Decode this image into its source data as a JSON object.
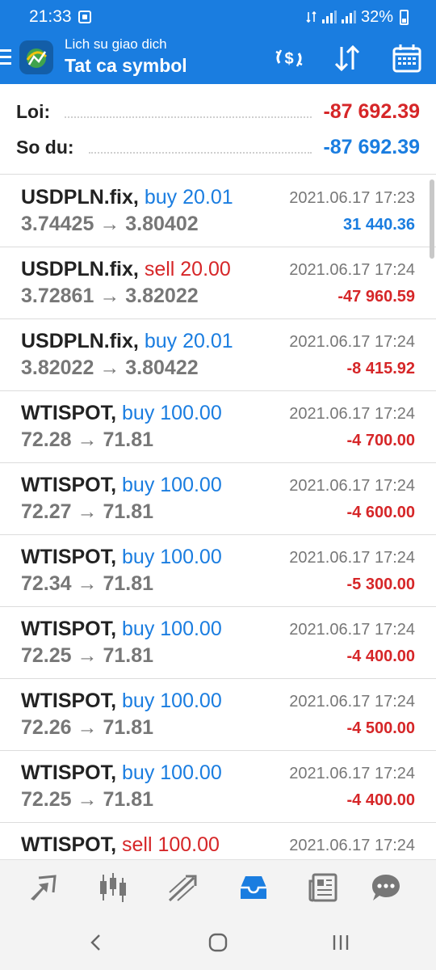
{
  "status_bar": {
    "time": "21:33",
    "battery": "32%"
  },
  "app_bar": {
    "subtitle": "Lich su giao dich",
    "title": "Tat ca symbol",
    "icons": [
      "menu-icon",
      "app-logo",
      "dollar-exchange-icon",
      "sort-arrows-icon",
      "calendar-icon"
    ]
  },
  "summary": {
    "profit_label": "Loi:",
    "profit_value": "-87 692.39",
    "balance_label": "So du:",
    "balance_value": "-87 692.39"
  },
  "deals": [
    {
      "symbol": "USDPLN.fix,",
      "side": "buy 20.01",
      "side_type": "buy",
      "prices": "3.74425 → 3.80402",
      "time": "2021.06.17 17:23",
      "profit": "31 440.36",
      "profit_sign": "positive"
    },
    {
      "symbol": "USDPLN.fix,",
      "side": "sell 20.00",
      "side_type": "sell",
      "prices": "3.72861 → 3.82022",
      "time": "2021.06.17 17:24",
      "profit": "-47 960.59",
      "profit_sign": "negative"
    },
    {
      "symbol": "USDPLN.fix,",
      "side": "buy 20.01",
      "side_type": "buy",
      "prices": "3.82022 → 3.80422",
      "time": "2021.06.17 17:24",
      "profit": "-8 415.92",
      "profit_sign": "negative"
    },
    {
      "symbol": "WTISPOT,",
      "side": "buy 100.00",
      "side_type": "buy",
      "prices": "72.28 → 71.81",
      "time": "2021.06.17 17:24",
      "profit": "-4 700.00",
      "profit_sign": "negative"
    },
    {
      "symbol": "WTISPOT,",
      "side": "buy 100.00",
      "side_type": "buy",
      "prices": "72.27 → 71.81",
      "time": "2021.06.17 17:24",
      "profit": "-4 600.00",
      "profit_sign": "negative"
    },
    {
      "symbol": "WTISPOT,",
      "side": "buy 100.00",
      "side_type": "buy",
      "prices": "72.34 → 71.81",
      "time": "2021.06.17 17:24",
      "profit": "-5 300.00",
      "profit_sign": "negative"
    },
    {
      "symbol": "WTISPOT,",
      "side": "buy 100.00",
      "side_type": "buy",
      "prices": "72.25 → 71.81",
      "time": "2021.06.17 17:24",
      "profit": "-4 400.00",
      "profit_sign": "negative"
    },
    {
      "symbol": "WTISPOT,",
      "side": "buy 100.00",
      "side_type": "buy",
      "prices": "72.26 → 71.81",
      "time": "2021.06.17 17:24",
      "profit": "-4 500.00",
      "profit_sign": "negative"
    },
    {
      "symbol": "WTISPOT,",
      "side": "buy 100.00",
      "side_type": "buy",
      "prices": "72.25 → 71.81",
      "time": "2021.06.17 17:24",
      "profit": "-4 400.00",
      "profit_sign": "negative"
    },
    {
      "symbol": "WTISPOT,",
      "side": "sell 100.00",
      "side_type": "sell",
      "prices": "",
      "time": "2021.06.17 17:24",
      "profit": "",
      "profit_sign": "negative"
    }
  ],
  "bottom_nav": {
    "items": [
      "quotes-icon",
      "chart-icon",
      "trade-icon",
      "history-icon",
      "news-icon",
      "chat-icon"
    ],
    "active": "history-icon"
  },
  "system_nav": {
    "items": [
      "back-icon",
      "home-icon",
      "recents-icon"
    ]
  },
  "colors": {
    "primary": "#1a7de0",
    "positive": "#1a7de0",
    "negative": "#d62628",
    "muted": "#777777"
  }
}
